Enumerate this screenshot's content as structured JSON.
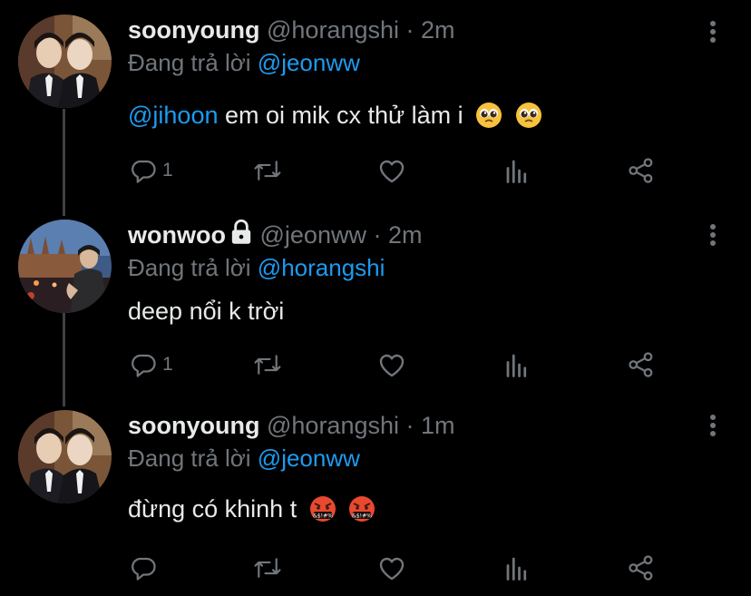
{
  "colors": {
    "background": "#000000",
    "text": "#e7e9ea",
    "muted": "#71767b",
    "accent": "#1d9bf0"
  },
  "tweets": [
    {
      "name": "soonyoung",
      "handle": "@horangshi",
      "sep": "·",
      "time": "2m",
      "reply_prefix": "Đang trả lời",
      "reply_to": "@jeonww",
      "mention": "@jihoon",
      "text": "em oi mik cx thử làm i",
      "emojis": [
        "pleading-face",
        "pleading-face"
      ],
      "reply_count": "1"
    },
    {
      "name": "wonwoo",
      "protected": true,
      "handle": "@jeonww",
      "sep": "·",
      "time": "2m",
      "reply_prefix": "Đang trả lời",
      "reply_to": "@horangshi",
      "text": "deep nổi k trời",
      "reply_count": "1"
    },
    {
      "name": "soonyoung",
      "handle": "@horangshi",
      "sep": "·",
      "time": "1m",
      "reply_prefix": "Đang trả lời",
      "reply_to": "@jeonww",
      "text": "đừng có khinh t",
      "emojis": [
        "cursing-face",
        "cursing-face"
      ],
      "reply_count": ""
    }
  ]
}
